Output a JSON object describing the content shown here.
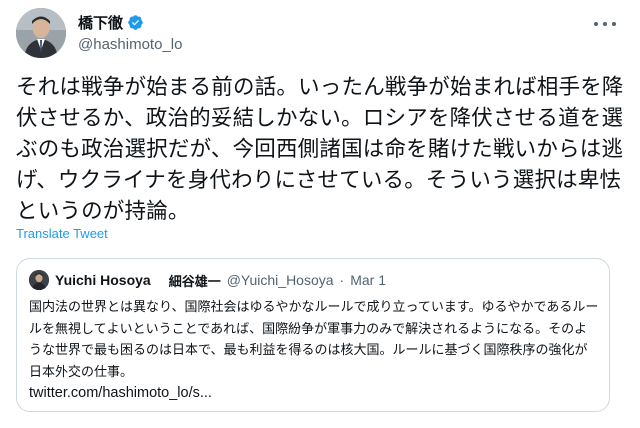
{
  "author": {
    "display_name": "橋下徹",
    "handle": "@hashimoto_lo",
    "verified": true,
    "avatar_icon": "profile-photo"
  },
  "tweet": {
    "text": "それは戦争が始まる前の話。いったん戦争が始まれば相手を降伏させるか、政治的妥結しかない。ロシアを降伏させる道を選ぶのも政治選択だが、今回西側諸国は命を賭けた戦いからは逃げ、ウクライナを身代わりにさせている。そういう選択は卑怯というのが持論。",
    "translate_label": "Translate Tweet"
  },
  "quoted_tweet": {
    "display_name": "Yuichi Hosoya",
    "display_name_jp": "細谷雄一",
    "handle": "@Yuichi_Hosoya",
    "separator": "·",
    "date": "Mar 1",
    "text": "国内法の世界とは異なり、国際社会はゆるやかなルールで成り立っています。ゆるやかであるルールを無視してよいということであれば、国際紛争が軍事力のみで解決されるようになる。そのような世界で最も困るのは日本で、最も利益を得るのは核大国。ルールに基づく国際秩序の強化が日本外交の仕事。",
    "link": "twitter.com/hashimoto_lo/s..."
  },
  "colors": {
    "accent": "#1d9bf0",
    "secondary_text": "#536471",
    "primary_text": "#0f1419",
    "border": "#cfd9de"
  }
}
